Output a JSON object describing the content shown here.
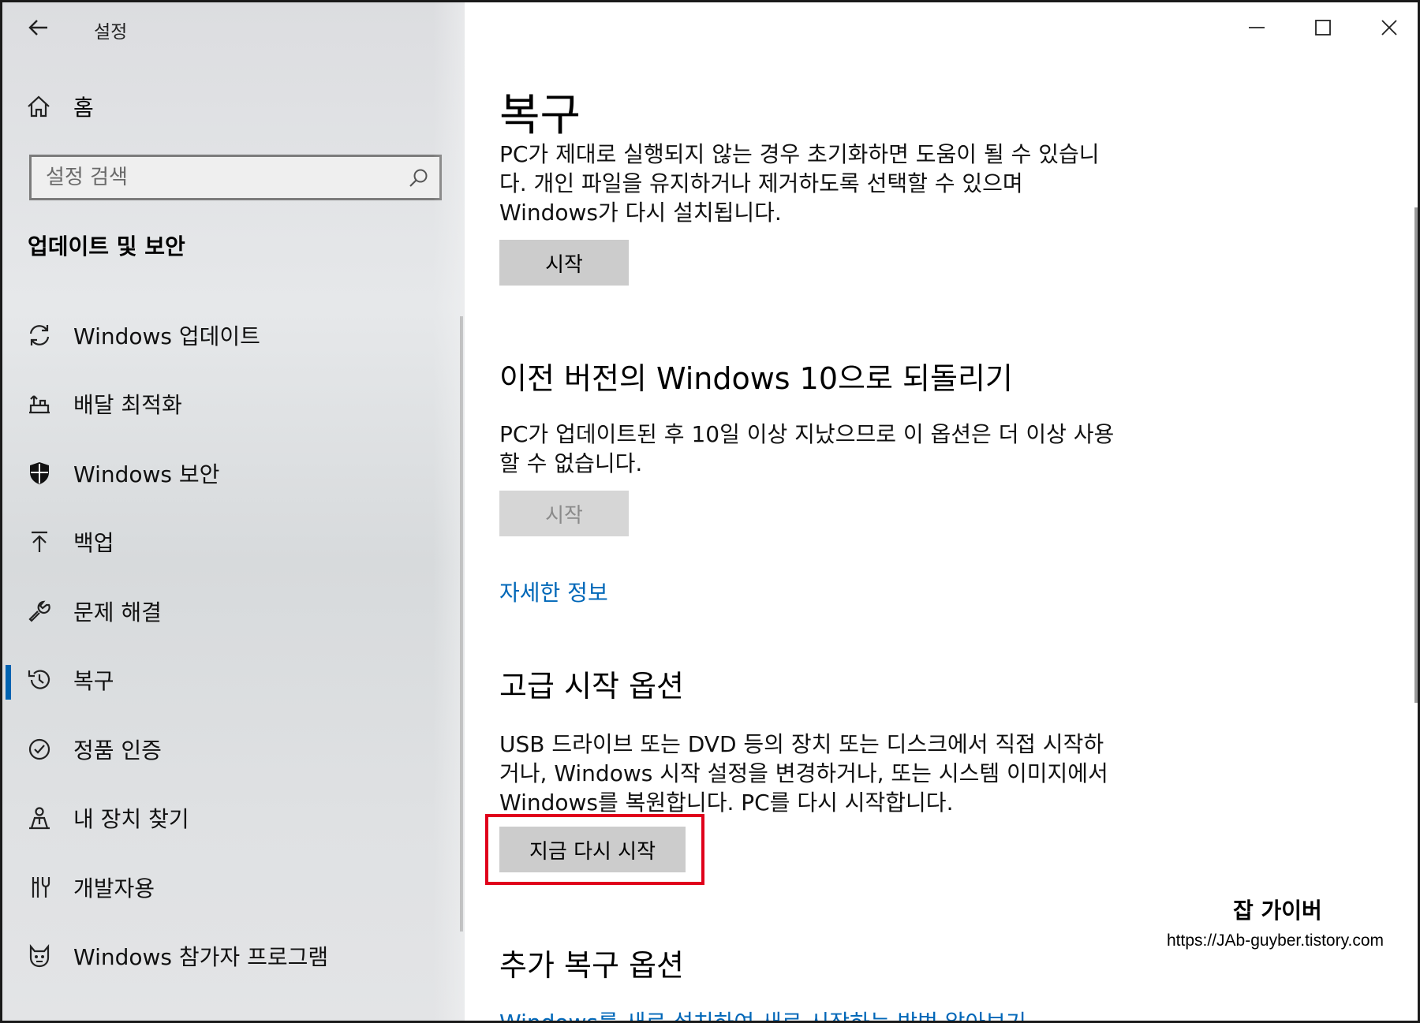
{
  "window": {
    "title": "설정",
    "controls": [
      "minimize-icon",
      "maximize-icon",
      "close-icon"
    ]
  },
  "sidebar": {
    "home_label": "홈",
    "search_placeholder": "설정 검색",
    "section_heading": "업데이트 및 보안",
    "items": [
      {
        "label": "Windows 업데이트",
        "icon": "sync-icon",
        "active": false
      },
      {
        "label": "배달 최적화",
        "icon": "delivery-icon",
        "active": false
      },
      {
        "label": "Windows 보안",
        "icon": "shield-icon",
        "active": false
      },
      {
        "label": "백업",
        "icon": "backup-arrow-icon",
        "active": false
      },
      {
        "label": "문제 해결",
        "icon": "wrench-icon",
        "active": false
      },
      {
        "label": "복구",
        "icon": "history-icon",
        "active": true
      },
      {
        "label": "정품 인증",
        "icon": "checkmark-circle-icon",
        "active": false
      },
      {
        "label": "내 장치 찾기",
        "icon": "person-locate-icon",
        "active": false
      },
      {
        "label": "개발자용",
        "icon": "developer-tools-icon",
        "active": false
      },
      {
        "label": "Windows 참가자 프로그램",
        "icon": "insider-cat-icon",
        "active": false
      }
    ],
    "active_accent": "#0063b1"
  },
  "main": {
    "title": "복구",
    "reset": {
      "text_lines": [
        "PC가 제대로 실행되지 않는 경우 초기화하면 도움이 될 수 있습니",
        "다. 개인 파일을 유지하거나 제거하도록 선택할 수 있으며",
        "Windows가 다시 설치됩니다."
      ],
      "button": "시작"
    },
    "goback": {
      "heading": "이전 버전의 Windows 10으로 되돌리기",
      "text_lines": [
        "PC가 업데이트된 후 10일 이상 지났으므로 이 옵션은 더 이상 사용",
        "할 수 없습니다."
      ],
      "button": "시작",
      "link": "자세한 정보"
    },
    "advanced": {
      "heading": "고급 시작 옵션",
      "text_lines": [
        "USB 드라이브 또는 DVD 등의 장치 또는 디스크에서 직접 시작하",
        "거나, Windows 시작 설정을 변경하거나, 또는 시스템 이미지에서",
        "Windows를 복원합니다. PC를 다시 시작합니다."
      ],
      "button": "지금 다시 시작",
      "highlight_color": "#e0001b"
    },
    "more": {
      "heading": "추가 복구 옵션",
      "link": "Windows를 새로 설치하여 새로 시작하는 방법 알아보기"
    },
    "link_color": "#0067b8"
  },
  "watermark": {
    "name": "잡 가이버",
    "url": "https://JAb-guyber.tistory.com"
  }
}
